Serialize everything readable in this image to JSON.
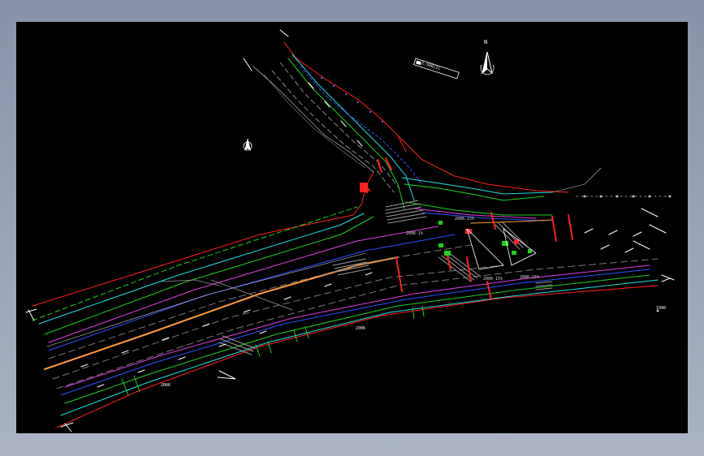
{
  "drawing": {
    "north_symbol": "north-arrow",
    "north_letter": "N",
    "legend_text": "1:500(2)",
    "labels": [
      "2006",
      "2006",
      "1990",
      "2006-15%",
      "2006-1%",
      "2006-15%",
      "2006-15%"
    ],
    "colors": {
      "background": "#000000",
      "frame": "#8e9bb0",
      "red": "#ff2020",
      "green": "#20d020",
      "cyan": "#20e0e0",
      "magenta": "#e040e0",
      "blue": "#3050ff",
      "yellow": "#f0f000",
      "orange": "#ff9a3c",
      "white": "#ffffff",
      "grey": "#9a9a9a"
    }
  }
}
